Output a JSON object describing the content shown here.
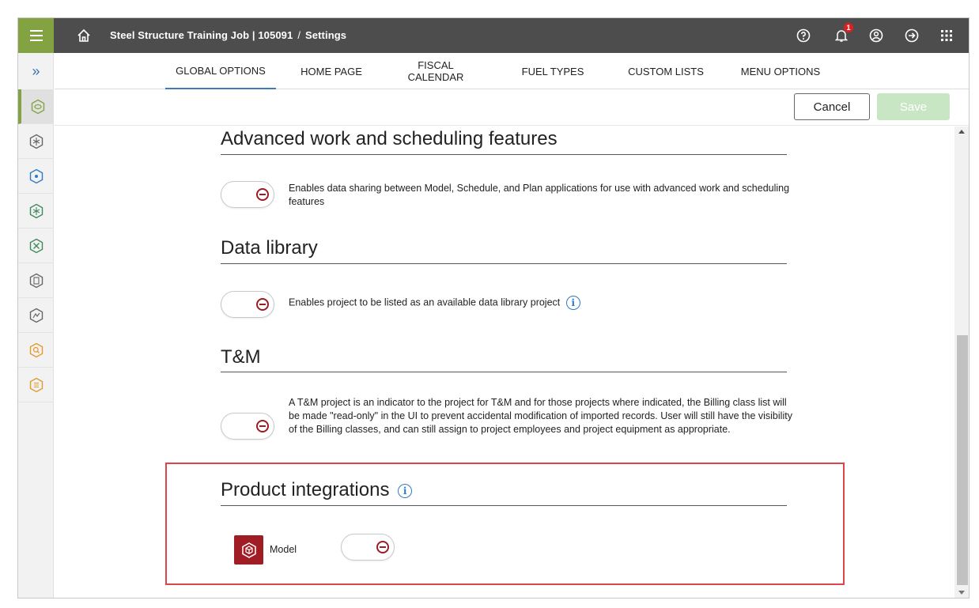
{
  "topbar": {
    "breadcrumb_project": "Steel Structure Training Job | 105091",
    "breadcrumb_sep": "/",
    "breadcrumb_page": "Settings",
    "notification_count": "1",
    "accent_color": "#83a343"
  },
  "tabs": [
    {
      "label": "GLOBAL OPTIONS",
      "active": true
    },
    {
      "label": "HOME PAGE"
    },
    {
      "label": "FISCAL CALENDAR"
    },
    {
      "label": "FUEL TYPES"
    },
    {
      "label": "CUSTOM LISTS"
    },
    {
      "label": "MENU OPTIONS"
    }
  ],
  "actions": {
    "cancel_label": "Cancel",
    "save_label": "Save"
  },
  "sections": {
    "advanced": {
      "title": "Advanced work and scheduling features",
      "description": "Enables data sharing between Model, Schedule, and Plan applications for use with advanced work and scheduling features",
      "enabled": false
    },
    "data_library": {
      "title": "Data library",
      "description": "Enables project to be listed as an available data library project",
      "enabled": false
    },
    "tm": {
      "title": "T&M",
      "description": "A T&M project is an indicator to the project for T&M and for those projects where indicated, the Billing class list will be made \"read-only\" in the UI to prevent accidental modification of imported records. User will still have the visibility of the Billing classes, and can still assign to project employees and project equipment as appropriate.",
      "enabled": false
    },
    "product_integrations": {
      "title": "Product integrations",
      "items": [
        {
          "label": "Model",
          "enabled": false
        }
      ]
    }
  },
  "colors": {
    "toggle_off": "#9b1c22",
    "highlight": "#e0444b",
    "model_tile": "#a11d25",
    "tab_active": "#3a7cc0"
  }
}
